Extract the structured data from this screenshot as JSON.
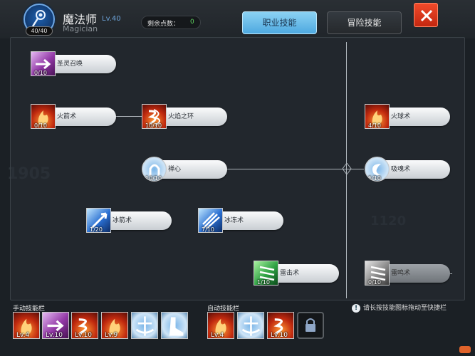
{
  "header": {
    "char_level_badge": "40/40",
    "class_name": "魔法师",
    "class_level": "Lv.40",
    "class_name_en": "Magician",
    "points_label": "剩余点数：",
    "points_value": "0",
    "tab_job": "职业技能",
    "tab_adventure": "冒险技能"
  },
  "skills": {
    "holy_summon": {
      "name": "圣灵召唤",
      "level": "0/10"
    },
    "fire_arrow": {
      "name": "火箭术",
      "level": "0/10"
    },
    "flame_ring": {
      "name": "火焰之环",
      "level": "10/10"
    },
    "fireball": {
      "name": "火球术",
      "level": "4/10"
    },
    "meditation": {
      "name": "禅心",
      "level": "10/10"
    },
    "soul_drain": {
      "name": "吸魂术",
      "level": "5/10"
    },
    "ice_arrow": {
      "name": "冰箭术",
      "level": "1/20"
    },
    "freeze": {
      "name": "冰冻术",
      "level": "7/10"
    },
    "thunder": {
      "name": "雷击术",
      "level": "1/10"
    },
    "thunder_roar": {
      "name": "雷鸣术",
      "level": "0/10"
    }
  },
  "manual_bar": {
    "label": "手动技能栏",
    "slots": [
      "Lv.4",
      "Lv.10",
      "Lv.10",
      "Lv.9",
      "",
      ""
    ]
  },
  "auto_bar": {
    "label": "自动技能栏",
    "slots": [
      "Lv.4",
      "",
      "Lv.10"
    ]
  },
  "hint": {
    "icon": "!",
    "text": "请长按技能图标拖动至快捷栏"
  },
  "colors": {
    "accent": "#4ea9e0",
    "close": "#d8361a",
    "points": "#5fd35f"
  }
}
